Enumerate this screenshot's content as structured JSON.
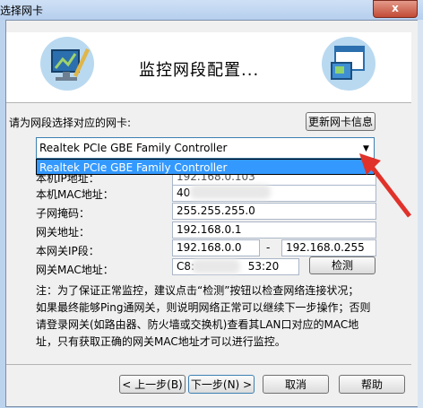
{
  "window": {
    "title": "选择网卡",
    "close_label": "x"
  },
  "header": {
    "title": "监控网段配置..."
  },
  "adapter": {
    "prompt": "请为网段选择对应的网卡:",
    "refresh_button": "更新网卡信息",
    "selected": "Realtek PCIe GBE Family Controller",
    "option": "Realtek PCIe GBE Family Controller"
  },
  "fields": {
    "ip_label": "本机IP地址：",
    "ip_value": "192.168.0.103",
    "mac_label": "本机MAC地址：",
    "mac_value": "40",
    "mask_label": "子网掩码：",
    "mask_value": "255.255.255.0",
    "gateway_label": "网关地址：",
    "gateway_value": "192.168.0.1",
    "range_label": "本网关IP段：",
    "range_start": "192.168.0.0",
    "range_sep": "-",
    "range_end": "192.168.0.255",
    "gwmac_label": "网关MAC地址：",
    "gwmac_prefix": "C8:",
    "gwmac_suffix": "53:20",
    "detect_button": "检测"
  },
  "note": {
    "line1": "注：为了保证正常监控，建议点击“检测”按钮以检查网络连接状况；",
    "line2": "如果最终能够Ping通网关，则说明网络正常可以继续下一步操作；否则",
    "line3": "请登录网关(如路由器、防火墙或交换机)查看其LAN口对应的MAC地",
    "line4": "址，只有获取正确的网关MAC地址才可以进行监控。"
  },
  "footer": {
    "back": "< 上一步(B)",
    "next": "下一步(N) >",
    "cancel": "取消",
    "help": "帮助"
  },
  "colors": {
    "selection": "#3399ff",
    "arrow": "#e0322a"
  },
  "icons": [
    "network-monitor-icon",
    "adapter-window-icon"
  ]
}
